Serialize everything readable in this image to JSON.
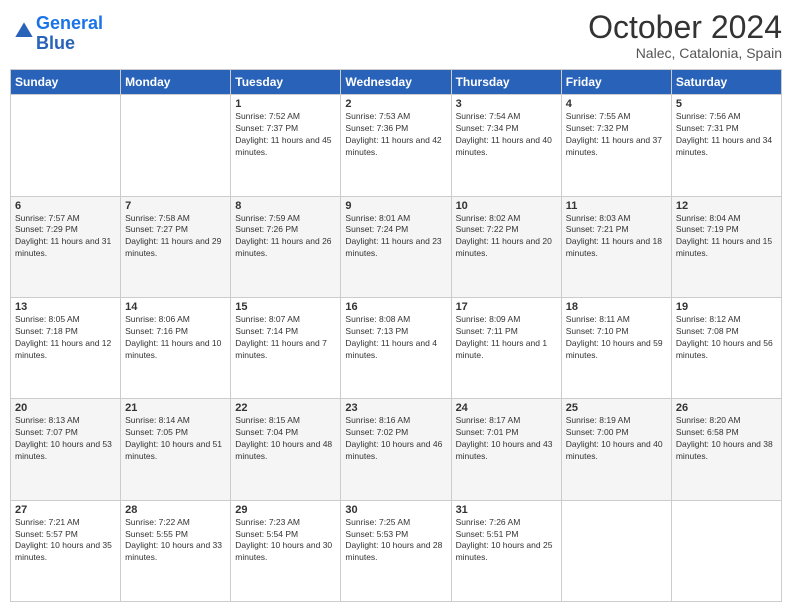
{
  "logo": {
    "line1": "General",
    "line2": "Blue"
  },
  "title": "October 2024",
  "subtitle": "Nalec, Catalonia, Spain",
  "headers": [
    "Sunday",
    "Monday",
    "Tuesday",
    "Wednesday",
    "Thursday",
    "Friday",
    "Saturday"
  ],
  "weeks": [
    [
      {
        "day": "",
        "info": ""
      },
      {
        "day": "",
        "info": ""
      },
      {
        "day": "1",
        "info": "Sunrise: 7:52 AM\nSunset: 7:37 PM\nDaylight: 11 hours and 45 minutes."
      },
      {
        "day": "2",
        "info": "Sunrise: 7:53 AM\nSunset: 7:36 PM\nDaylight: 11 hours and 42 minutes."
      },
      {
        "day": "3",
        "info": "Sunrise: 7:54 AM\nSunset: 7:34 PM\nDaylight: 11 hours and 40 minutes."
      },
      {
        "day": "4",
        "info": "Sunrise: 7:55 AM\nSunset: 7:32 PM\nDaylight: 11 hours and 37 minutes."
      },
      {
        "day": "5",
        "info": "Sunrise: 7:56 AM\nSunset: 7:31 PM\nDaylight: 11 hours and 34 minutes."
      }
    ],
    [
      {
        "day": "6",
        "info": "Sunrise: 7:57 AM\nSunset: 7:29 PM\nDaylight: 11 hours and 31 minutes."
      },
      {
        "day": "7",
        "info": "Sunrise: 7:58 AM\nSunset: 7:27 PM\nDaylight: 11 hours and 29 minutes."
      },
      {
        "day": "8",
        "info": "Sunrise: 7:59 AM\nSunset: 7:26 PM\nDaylight: 11 hours and 26 minutes."
      },
      {
        "day": "9",
        "info": "Sunrise: 8:01 AM\nSunset: 7:24 PM\nDaylight: 11 hours and 23 minutes."
      },
      {
        "day": "10",
        "info": "Sunrise: 8:02 AM\nSunset: 7:22 PM\nDaylight: 11 hours and 20 minutes."
      },
      {
        "day": "11",
        "info": "Sunrise: 8:03 AM\nSunset: 7:21 PM\nDaylight: 11 hours and 18 minutes."
      },
      {
        "day": "12",
        "info": "Sunrise: 8:04 AM\nSunset: 7:19 PM\nDaylight: 11 hours and 15 minutes."
      }
    ],
    [
      {
        "day": "13",
        "info": "Sunrise: 8:05 AM\nSunset: 7:18 PM\nDaylight: 11 hours and 12 minutes."
      },
      {
        "day": "14",
        "info": "Sunrise: 8:06 AM\nSunset: 7:16 PM\nDaylight: 11 hours and 10 minutes."
      },
      {
        "day": "15",
        "info": "Sunrise: 8:07 AM\nSunset: 7:14 PM\nDaylight: 11 hours and 7 minutes."
      },
      {
        "day": "16",
        "info": "Sunrise: 8:08 AM\nSunset: 7:13 PM\nDaylight: 11 hours and 4 minutes."
      },
      {
        "day": "17",
        "info": "Sunrise: 8:09 AM\nSunset: 7:11 PM\nDaylight: 11 hours and 1 minute."
      },
      {
        "day": "18",
        "info": "Sunrise: 8:11 AM\nSunset: 7:10 PM\nDaylight: 10 hours and 59 minutes."
      },
      {
        "day": "19",
        "info": "Sunrise: 8:12 AM\nSunset: 7:08 PM\nDaylight: 10 hours and 56 minutes."
      }
    ],
    [
      {
        "day": "20",
        "info": "Sunrise: 8:13 AM\nSunset: 7:07 PM\nDaylight: 10 hours and 53 minutes."
      },
      {
        "day": "21",
        "info": "Sunrise: 8:14 AM\nSunset: 7:05 PM\nDaylight: 10 hours and 51 minutes."
      },
      {
        "day": "22",
        "info": "Sunrise: 8:15 AM\nSunset: 7:04 PM\nDaylight: 10 hours and 48 minutes."
      },
      {
        "day": "23",
        "info": "Sunrise: 8:16 AM\nSunset: 7:02 PM\nDaylight: 10 hours and 46 minutes."
      },
      {
        "day": "24",
        "info": "Sunrise: 8:17 AM\nSunset: 7:01 PM\nDaylight: 10 hours and 43 minutes."
      },
      {
        "day": "25",
        "info": "Sunrise: 8:19 AM\nSunset: 7:00 PM\nDaylight: 10 hours and 40 minutes."
      },
      {
        "day": "26",
        "info": "Sunrise: 8:20 AM\nSunset: 6:58 PM\nDaylight: 10 hours and 38 minutes."
      }
    ],
    [
      {
        "day": "27",
        "info": "Sunrise: 7:21 AM\nSunset: 5:57 PM\nDaylight: 10 hours and 35 minutes."
      },
      {
        "day": "28",
        "info": "Sunrise: 7:22 AM\nSunset: 5:55 PM\nDaylight: 10 hours and 33 minutes."
      },
      {
        "day": "29",
        "info": "Sunrise: 7:23 AM\nSunset: 5:54 PM\nDaylight: 10 hours and 30 minutes."
      },
      {
        "day": "30",
        "info": "Sunrise: 7:25 AM\nSunset: 5:53 PM\nDaylight: 10 hours and 28 minutes."
      },
      {
        "day": "31",
        "info": "Sunrise: 7:26 AM\nSunset: 5:51 PM\nDaylight: 10 hours and 25 minutes."
      },
      {
        "day": "",
        "info": ""
      },
      {
        "day": "",
        "info": ""
      }
    ]
  ]
}
